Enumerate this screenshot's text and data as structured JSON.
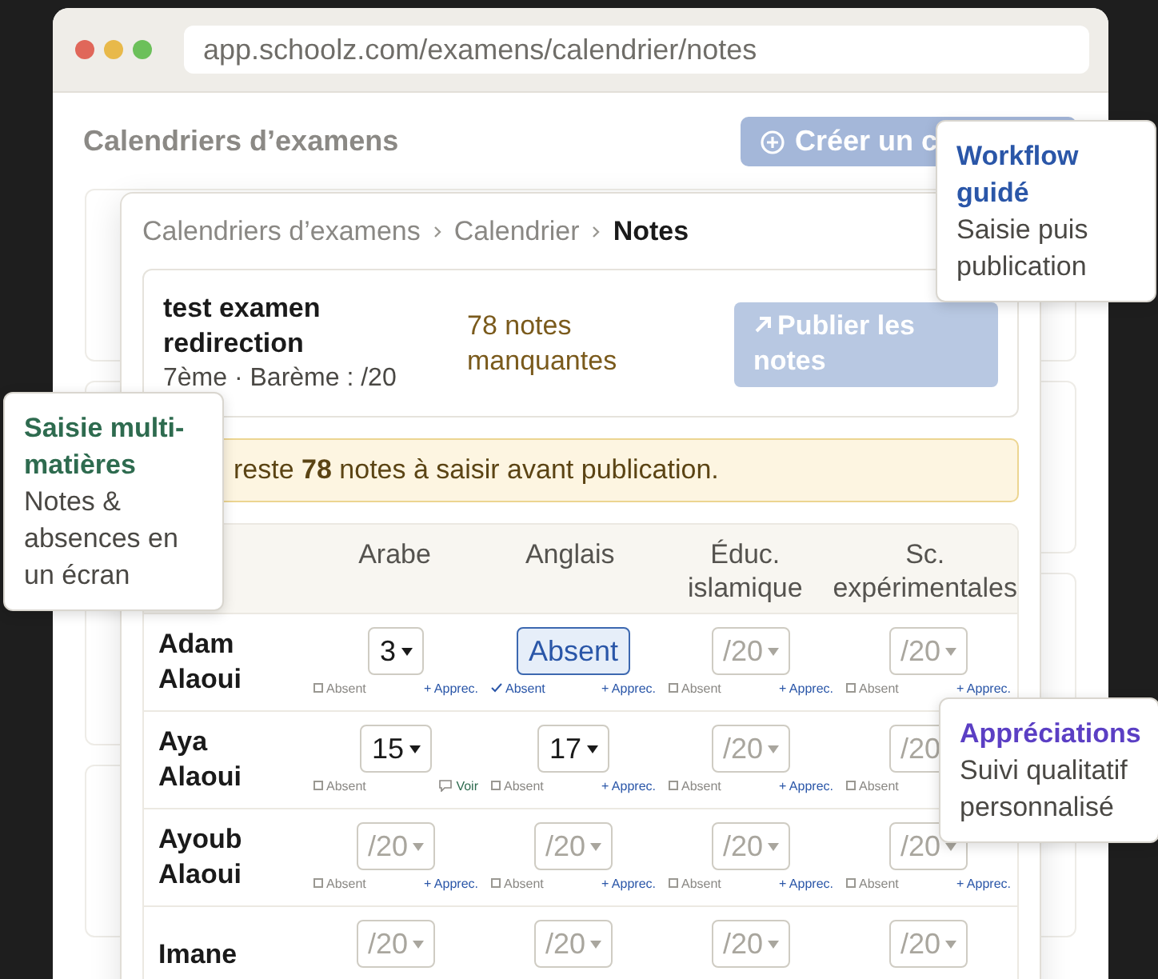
{
  "browser": {
    "url": "app.schoolz.com/examens/calendrier/notes"
  },
  "page": {
    "title": "Calendriers d’examens",
    "create_button": {
      "label": "Créer un c",
      "disabled": true
    }
  },
  "modal": {
    "breadcrumb": [
      {
        "label": "Calendriers d’examens",
        "current": false
      },
      {
        "label": "Calendrier",
        "current": false
      },
      {
        "label": "Notes",
        "current": true
      }
    ],
    "exam": {
      "title": "test examen redirection",
      "meta": "7ème · Barème : /20",
      "missing": "78 notes manquantes",
      "publish_button": {
        "label": "Publier les notes",
        "disabled": true
      }
    },
    "alert": "reste **78** notes à saisir avant publication.",
    "table": {
      "columns": [
        "Arabe",
        "Anglais",
        "Éduc. islamique",
        "Sc. expérimentales"
      ],
      "rows": [
        {
          "name": "Adam Alaoui",
          "cells": [
            {
              "value": "3",
              "absent_label": "Absent",
              "absent": false,
              "link": {
                "kind": "add",
                "label": "+ Apprec."
              }
            },
            {
              "value": "Absent",
              "absent_label": "Absent",
              "absent": true,
              "link": {
                "kind": "add",
                "label": "+ Apprec."
              }
            },
            {
              "placeholder": "/20",
              "absent_label": "Absent",
              "absent": false,
              "link": {
                "kind": "add",
                "label": "+ Apprec."
              }
            },
            {
              "placeholder": "/20",
              "absent_label": "Absent",
              "absent": false,
              "link": {
                "kind": "add",
                "label": "+ Apprec."
              }
            }
          ]
        },
        {
          "name": "Aya Alaoui",
          "cells": [
            {
              "value": "15",
              "absent_label": "Absent",
              "absent": false,
              "link": {
                "kind": "view",
                "label": "Voir"
              }
            },
            {
              "value": "17",
              "absent_label": "Absent",
              "absent": false,
              "link": {
                "kind": "add",
                "label": "+ Apprec."
              }
            },
            {
              "placeholder": "/20",
              "absent_label": "Absent",
              "absent": false,
              "link": {
                "kind": "add",
                "label": "+ Apprec."
              }
            },
            {
              "placeholder": "/20",
              "absent_label": "Absent",
              "absent": false
            }
          ]
        },
        {
          "name": "Ayoub Alaoui",
          "cells": [
            {
              "placeholder": "/20",
              "absent_label": "Absent",
              "absent": false,
              "link": {
                "kind": "add",
                "label": "+ Apprec."
              }
            },
            {
              "placeholder": "/20",
              "absent_label": "Absent",
              "absent": false,
              "link": {
                "kind": "add",
                "label": "+ Apprec."
              }
            },
            {
              "placeholder": "/20",
              "absent_label": "Absent",
              "absent": false,
              "link": {
                "kind": "add",
                "label": "+ Apprec."
              }
            },
            {
              "placeholder": "/20",
              "absent_label": "Absent",
              "absent": false,
              "link": {
                "kind": "add",
                "label": "+ Apprec."
              }
            }
          ]
        },
        {
          "name": "Imane",
          "cells": [
            {
              "placeholder": "/20",
              "absent": false
            },
            {
              "placeholder": "/20",
              "absent": false
            },
            {
              "placeholder": "/20",
              "absent": false
            },
            {
              "placeholder": "/20",
              "absent": false
            }
          ]
        }
      ]
    }
  },
  "callouts": [
    {
      "title": "Workflow guidé",
      "text": "Saisie puis publication",
      "color": "#2a56a8"
    },
    {
      "title": "Saisie multi-matières",
      "text": "Notes & absences en un écran",
      "color": "#2e6b4f"
    },
    {
      "title": "Appréciations",
      "text": "Suivi qualitatif personnalisé",
      "color": "#5b3fc4"
    }
  ]
}
